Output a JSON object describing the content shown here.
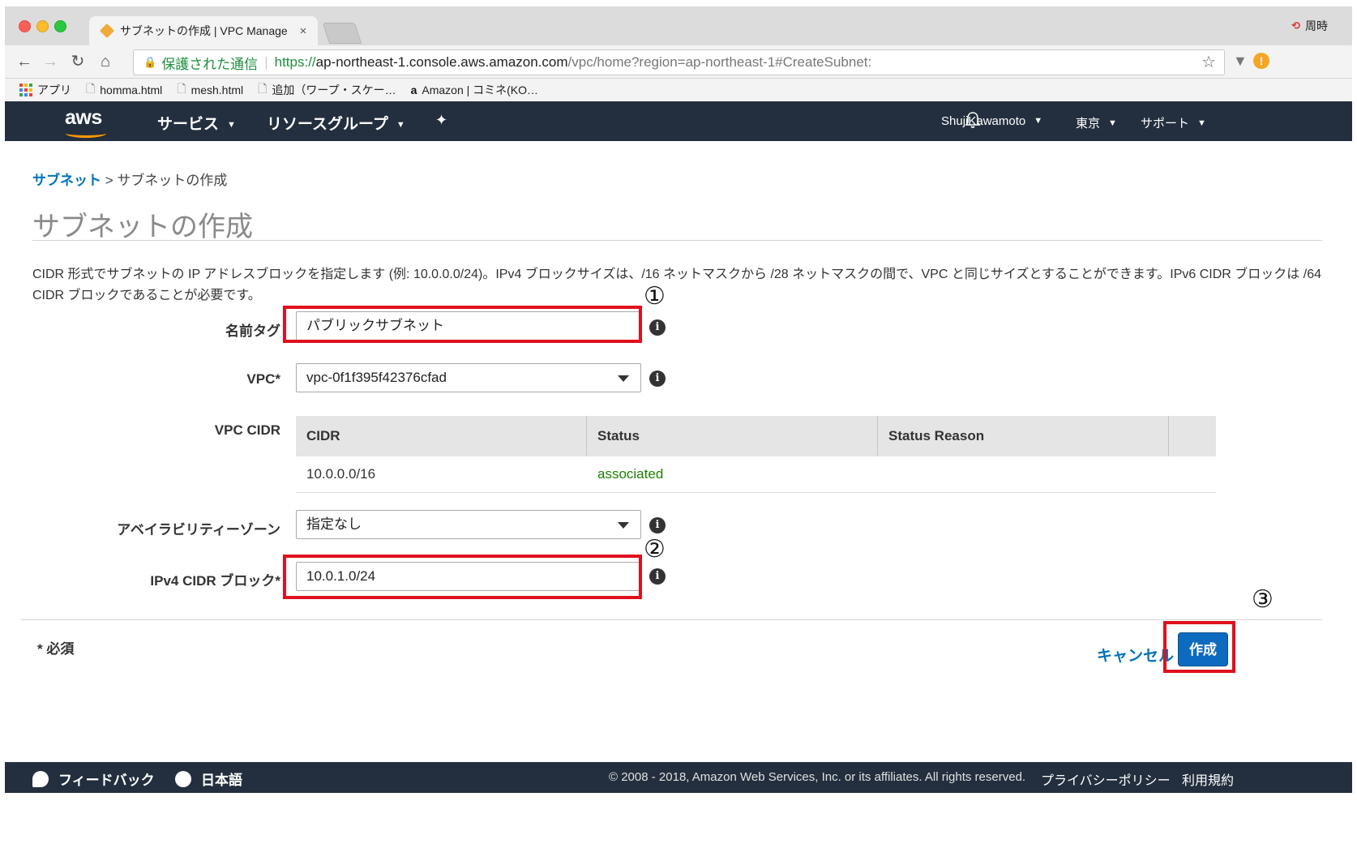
{
  "browser": {
    "tab_title": "サブネットの作成 | VPC Manage",
    "tab_close": "×",
    "profile_label": "周時",
    "secure_label": "保護された通信",
    "url_scheme": "https://",
    "url_host": "ap-northeast-1.console.aws.amazon.com",
    "url_path": "/vpc/home?region=ap-northeast-1#CreateSubnet:",
    "bookmarks": [
      {
        "label": "アプリ",
        "icon": "apps-icon"
      },
      {
        "label": "homma.html",
        "icon": "page-icon"
      },
      {
        "label": "mesh.html",
        "icon": "page-icon"
      },
      {
        "label": "追加（ワープ・スケー…",
        "icon": "page-icon"
      },
      {
        "label": "Amazon | コミネ(KO…",
        "icon": "amazon-icon"
      }
    ]
  },
  "aws_nav": {
    "logo": "aws",
    "services": "サービス",
    "resource_groups": "リソースグループ",
    "user": "ShujiKawamoto",
    "region": "東京",
    "support": "サポート"
  },
  "page": {
    "breadcrumb_link": "サブネット",
    "breadcrumb_sep": ">",
    "breadcrumb_current": "サブネットの作成",
    "title": "サブネットの作成",
    "description": "CIDR 形式でサブネットの IP アドレスブロックを指定します (例: 10.0.0.0/24)。IPv4 ブロックサイズは、/16 ネットマスクから /28 ネットマスクの間で、VPC と同じサイズとすることができます。IPv6 CIDR ブロックは /64 CIDR ブロックであることが必要です。"
  },
  "form": {
    "name_tag_label": "名前タグ",
    "name_tag_value": "パブリックサブネット",
    "vpc_label": "VPC*",
    "vpc_value": "vpc-0f1f395f42376cfad",
    "vpc_cidr_label": "VPC CIDR",
    "cidr_headers": [
      "CIDR",
      "Status",
      "Status Reason"
    ],
    "cidr_rows": [
      {
        "cidr": "10.0.0.0/16",
        "status": "associated",
        "reason": ""
      }
    ],
    "az_label": "アベイラビリティーゾーン",
    "az_value": "指定なし",
    "ipv4_label": "IPv4 CIDR ブロック*",
    "ipv4_value": "10.0.1.0/24",
    "info_glyph": "i"
  },
  "actions": {
    "required_note": "* 必須",
    "cancel": "キャンセル",
    "create": "作成"
  },
  "annotations": [
    "①",
    "②",
    "③"
  ],
  "footer": {
    "feedback": "フィードバック",
    "language": "日本語",
    "copyright": "© 2008 - 2018, Amazon Web Services, Inc. or its affiliates. All rights reserved.",
    "privacy": "プライバシーポリシー",
    "terms": "利用規約"
  },
  "colors": {
    "aws_nav_bg": "#232f3e",
    "link_blue": "#0073bb",
    "primary_button": "#0d6bbf",
    "status_green": "#1d8102",
    "annotation_red": "#e0101e",
    "aws_orange": "#ff9900"
  }
}
